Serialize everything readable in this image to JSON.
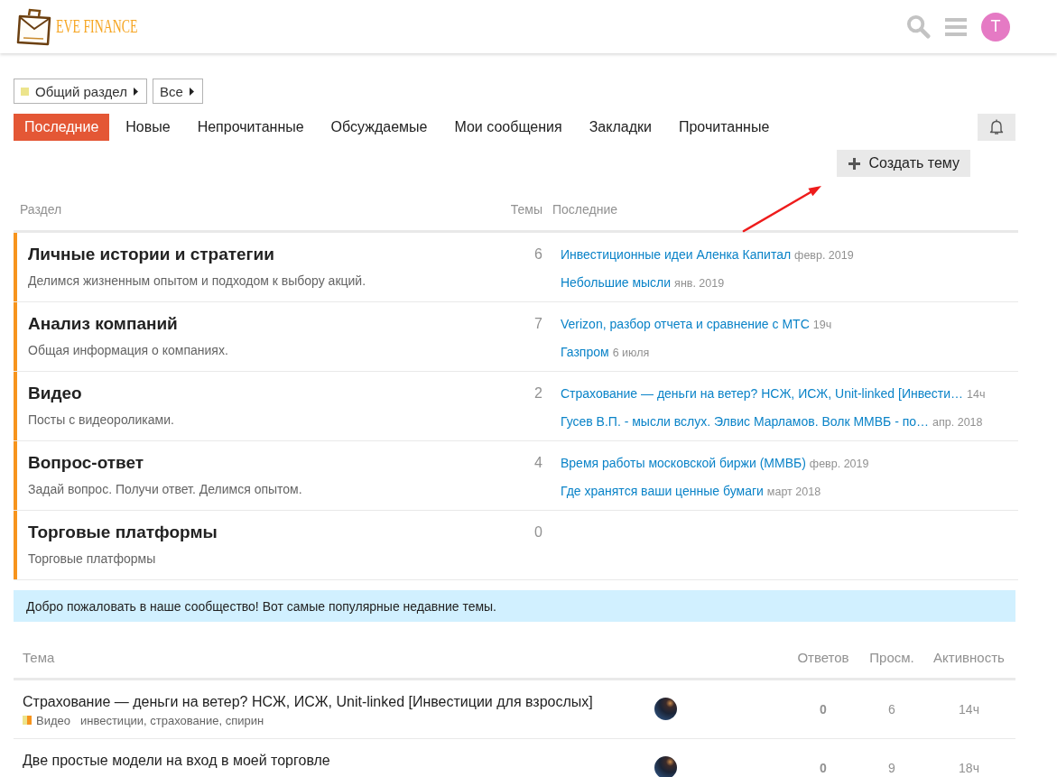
{
  "header": {
    "logo_text": "EVE FINANCE",
    "user_initial": "T"
  },
  "breadcrumbs": [
    {
      "label": "Общий раздел",
      "color": "#ece48c"
    },
    {
      "label": "Все"
    }
  ],
  "nav_tabs": [
    {
      "label": "Последние",
      "selected": true
    },
    {
      "label": "Новые",
      "selected": false
    },
    {
      "label": "Непрочитанные",
      "selected": false
    },
    {
      "label": "Обсуждаемые",
      "selected": false
    },
    {
      "label": "Мои сообщения",
      "selected": false
    },
    {
      "label": "Закладки",
      "selected": false
    },
    {
      "label": "Прочитанные",
      "selected": false
    }
  ],
  "create_button": "Создать тему",
  "categories_table": {
    "columns": [
      "Раздел",
      "Темы",
      "Последние"
    ],
    "rows": [
      {
        "name": "Личные истории и стратегии",
        "description": "Делимся жизненным опытом и подходом к выбору акций.",
        "topics_count": "6",
        "color": "#f7941d",
        "latest": [
          {
            "title": "Инвестиционные идеи Аленка Капитал",
            "date": "февр. 2019"
          },
          {
            "title": "Небольшие мысли",
            "date": "янв. 2019"
          }
        ]
      },
      {
        "name": "Анализ компаний",
        "description": "Общая информация о компаниях.",
        "topics_count": "7",
        "color": "#f7941d",
        "latest": [
          {
            "title": "Verizon, разбор отчета и сравнение с МТС",
            "date": "19ч"
          },
          {
            "title": "Газпром",
            "date": "6 июля"
          }
        ]
      },
      {
        "name": "Видео",
        "description": "Посты с видеороликами.",
        "topics_count": "2",
        "color": "#f7941d",
        "latest": [
          {
            "title": "Страхование — деньги на ветер? НСЖ, ИСЖ, Unit-linked [Инвести…",
            "date": "14ч"
          },
          {
            "title": "Гусев В.П. - мысли вслух. Элвис Марламов. Волк ММВБ - по…",
            "date": "апр. 2018"
          }
        ]
      },
      {
        "name": "Вопрос-ответ",
        "description": "Задай вопрос. Получи ответ. Делимся опытом.",
        "topics_count": "4",
        "color": "#f7941d",
        "latest": [
          {
            "title": "Время работы московской биржи (ММВБ)",
            "date": "февр. 2019"
          },
          {
            "title": "Где хранятся ваши ценные бумаги",
            "date": "март 2018"
          }
        ]
      },
      {
        "name": "Торговые платформы",
        "description": "Торговые платформы",
        "topics_count": "0",
        "color": "#f7941d"
      }
    ]
  },
  "welcome_banner": "Добро пожаловать в наше сообщество! Вот самые популярные недавние темы.",
  "topics_table": {
    "columns": [
      "Тема",
      "Ответов",
      "Просм.",
      "Активность"
    ],
    "rows": [
      {
        "title": "Страхование — деньги на ветер? НСЖ, ИСЖ, Unit-linked [Инвестиции для взрослых]",
        "category": {
          "name": "Видео",
          "color": "#f7941d",
          "parent": {
            "color": "#ece48c"
          }
        },
        "tags": "инвестиции, страхование, спирин",
        "replies": "0",
        "views": "6",
        "activity": "14ч"
      },
      {
        "title": "Две простые модели на вход в моей торговле",
        "replies": "0",
        "views": "9",
        "activity": "18ч"
      }
    ]
  }
}
